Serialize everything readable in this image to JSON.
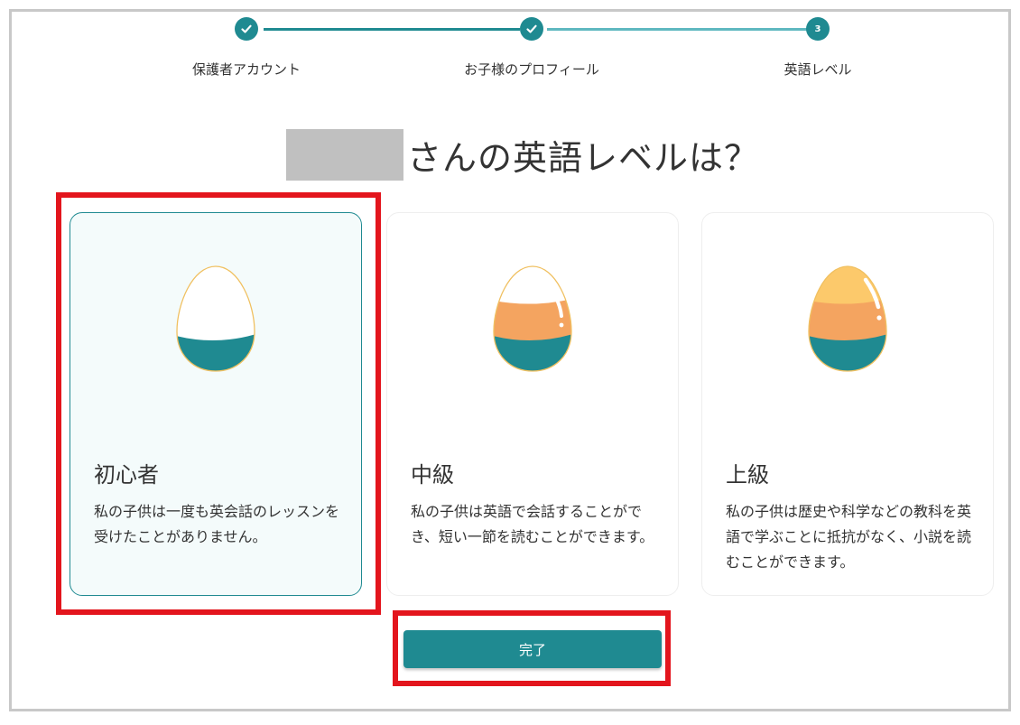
{
  "colors": {
    "accent": "#1f8a91",
    "highlight_border": "#e3151d",
    "egg_orange": "#f4a460",
    "egg_yellow": "#fcc96b"
  },
  "stepper": {
    "steps": [
      {
        "label": "保護者アカウント",
        "state": "completed",
        "icon": "check-icon"
      },
      {
        "label": "お子様のプロフィール",
        "state": "completed",
        "icon": "check-icon"
      },
      {
        "label": "英語レベル",
        "state": "current",
        "number": "3"
      }
    ]
  },
  "title": {
    "question": "さんの英語レベルは？"
  },
  "levels": [
    {
      "name": "初心者",
      "description": "私の子供は一度も英会話のレッスンを受けたことがありません。",
      "selected": true,
      "icon": "egg-beginner-icon"
    },
    {
      "name": "中級",
      "description": "私の子供は英語で会話することができ、短い一節を読むことができます。",
      "selected": false,
      "icon": "egg-intermediate-icon"
    },
    {
      "name": "上級",
      "description": "私の子供は歴史や科学などの教科を英語で学ぶことに抵抗がなく、小説を読むことができます。",
      "selected": false,
      "icon": "egg-advanced-icon"
    }
  ],
  "actions": {
    "done_label": "完了"
  }
}
